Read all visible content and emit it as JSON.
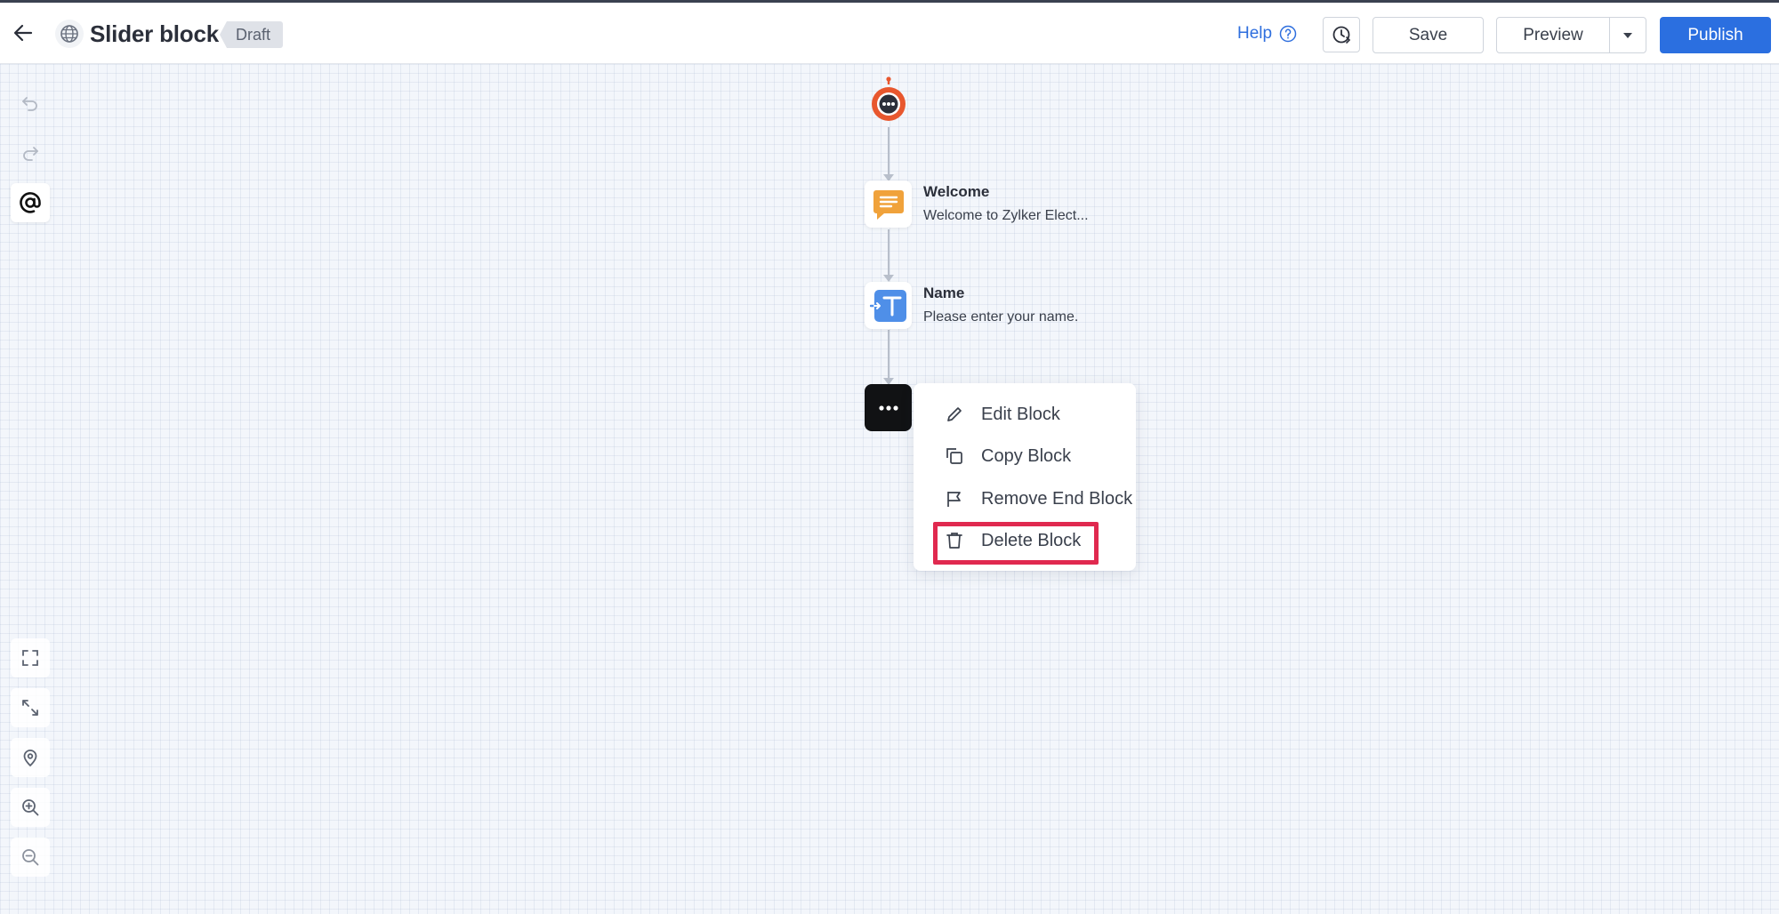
{
  "header": {
    "title": "Slider block",
    "status_badge": "Draft",
    "help_label": "Help",
    "save_label": "Save",
    "preview_label": "Preview",
    "publish_label": "Publish"
  },
  "flow": {
    "nodes": [
      {
        "title": "Welcome",
        "subtitle": "Welcome to Zylker Elect...",
        "icon": "message-icon"
      },
      {
        "title": "Name",
        "subtitle": "Please enter your name.",
        "icon": "text-input-icon"
      }
    ],
    "end_node_icon": "more-icon"
  },
  "context_menu": {
    "items": [
      {
        "label": "Edit Block",
        "icon": "pencil-icon"
      },
      {
        "label": "Copy Block",
        "icon": "copy-icon"
      },
      {
        "label": "Remove End Block",
        "icon": "flag-icon"
      },
      {
        "label": "Delete Block",
        "icon": "trash-icon"
      }
    ],
    "highlighted_item": "Delete Block"
  },
  "left_toolbar": {
    "top": [
      "undo-icon",
      "redo-icon",
      "mention-icon"
    ],
    "bottom": [
      "fit-screen-icon",
      "expand-icon",
      "locate-icon",
      "zoom-in-icon",
      "zoom-out-icon"
    ]
  },
  "colors": {
    "primary": "#2b6fe0",
    "highlight": "#e0294f",
    "bot_orange": "#e8572e",
    "welcome_orange": "#f0a23b",
    "name_blue": "#4f8fe8"
  }
}
